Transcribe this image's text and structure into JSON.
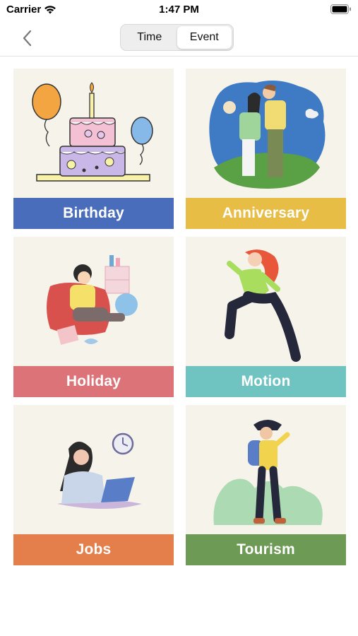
{
  "status_bar": {
    "carrier": "Carrier",
    "time": "1:47 PM",
    "wifi_icon": "wifi-icon",
    "battery_icon": "battery-icon"
  },
  "nav": {
    "back_icon": "chevron-left-icon",
    "segments": [
      {
        "label": "Time",
        "selected": false
      },
      {
        "label": "Event",
        "selected": true
      }
    ]
  },
  "categories": [
    {
      "label": "Birthday",
      "color": "#4a6dbb",
      "illustration": "birthday-cake-illustration"
    },
    {
      "label": "Anniversary",
      "color": "#e8bd45",
      "illustration": "couple-kissing-illustration"
    },
    {
      "label": "Holiday",
      "color": "#db7378",
      "illustration": "person-relaxing-illustration"
    },
    {
      "label": "Motion",
      "color": "#6fc4c1",
      "illustration": "person-running-illustration"
    },
    {
      "label": "Jobs",
      "color": "#e47f4c",
      "illustration": "person-at-laptop-illustration"
    },
    {
      "label": "Tourism",
      "color": "#6d9a55",
      "illustration": "hiker-illustration"
    }
  ]
}
